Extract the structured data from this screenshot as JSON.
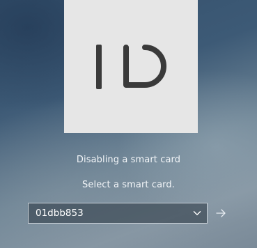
{
  "tile": {
    "logo_icon": "id-card-logo-icon",
    "logo_text": "ID"
  },
  "messages": {
    "title": "Disabling a smart card",
    "instruction": "Select a smart card."
  },
  "card_select": {
    "value": "01dbb853",
    "dropdown_icon": "chevron-down-icon"
  },
  "submit": {
    "icon": "arrow-right-icon"
  },
  "colors": {
    "tile_background": "#e6e6e6",
    "logo": "#3a3a3a",
    "text": "#f2f5f8"
  }
}
